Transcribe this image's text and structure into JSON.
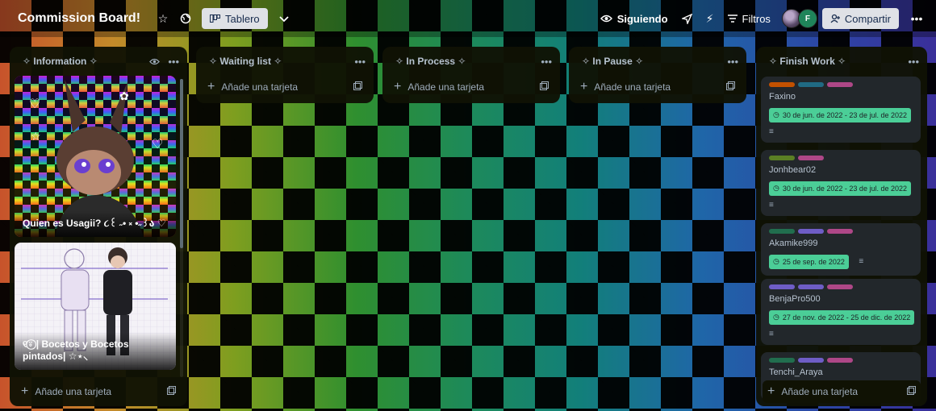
{
  "header": {
    "title": "Commission Board!",
    "view_label": "Tablero",
    "follow_label": "Siguiendo",
    "filter_label": "Filtros",
    "avatar_initial": "F",
    "share_label": "Compartir"
  },
  "add_card_label": "Añade una tarjeta",
  "lists": {
    "information": {
      "title": "✧ Information ✧",
      "cards": [
        {
          "caption": "Quien es Usagii? ૮꒰ ˶• ༝ •˶꒱ა ♡"
        },
        {
          "caption": "୧⍤⃝ | Bocetos y Bocetos pintados| ☆⋆⸜"
        }
      ]
    },
    "waiting": {
      "title": "✧ Waiting list ✧"
    },
    "process": {
      "title": "✧ In Process ✧"
    },
    "pause": {
      "title": "✧ In Pause ✧"
    },
    "finish": {
      "title": "✧ Finish Work ✧",
      "cards": [
        {
          "name": "Faxino",
          "due": "30 de jun. de 2022 - 23 de jul. de 2022",
          "labels": [
            "#c25100",
            "#206a83",
            "#ae4787"
          ]
        },
        {
          "name": "Jonhbear02",
          "due": "30 de jun. de 2022 - 23 de jul. de 2022",
          "labels": [
            "#5b7f24",
            "#ae4787"
          ]
        },
        {
          "name": "Akamike999",
          "due": "25 de sep. de 2022",
          "labels": [
            "#216e4e",
            "#6e5dc6",
            "#ae4787"
          ]
        },
        {
          "name": "BenjaPro500",
          "due": "27 de nov. de 2022 - 25 de dic. de 2022",
          "labels": [
            "#6e5dc6",
            "#6e5dc6",
            "#ae4787"
          ]
        },
        {
          "name": "Tenchi_Araya",
          "labels": [
            "#216e4e",
            "#6e5dc6",
            "#ae4787"
          ]
        }
      ]
    }
  },
  "colors": {
    "list_bg": "#101204",
    "card_bg": "#22272b",
    "due_green": "#4bce97"
  }
}
